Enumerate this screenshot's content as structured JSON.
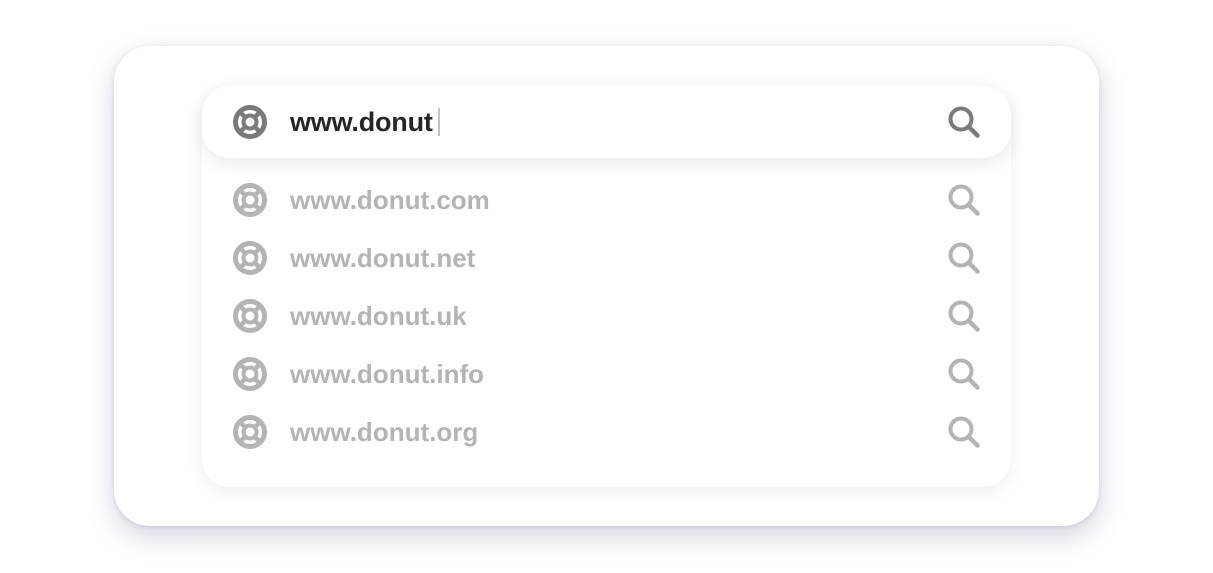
{
  "search": {
    "query": "www.donut",
    "leading_icon": "lifebuoy-icon",
    "trailing_icon": "search-icon"
  },
  "suggestions": [
    {
      "label": "www.donut.com"
    },
    {
      "label": "www.donut.net"
    },
    {
      "label": "www.donut.uk"
    },
    {
      "label": "www.donut.info"
    },
    {
      "label": "www.donut.org"
    }
  ],
  "colors": {
    "query_text": "#262626",
    "active_icon": "#7a7a7a",
    "suggestion_text": "#b4b4b4",
    "suggestion_icon": "#b4b4b4",
    "caret": "#c2c2c2"
  }
}
